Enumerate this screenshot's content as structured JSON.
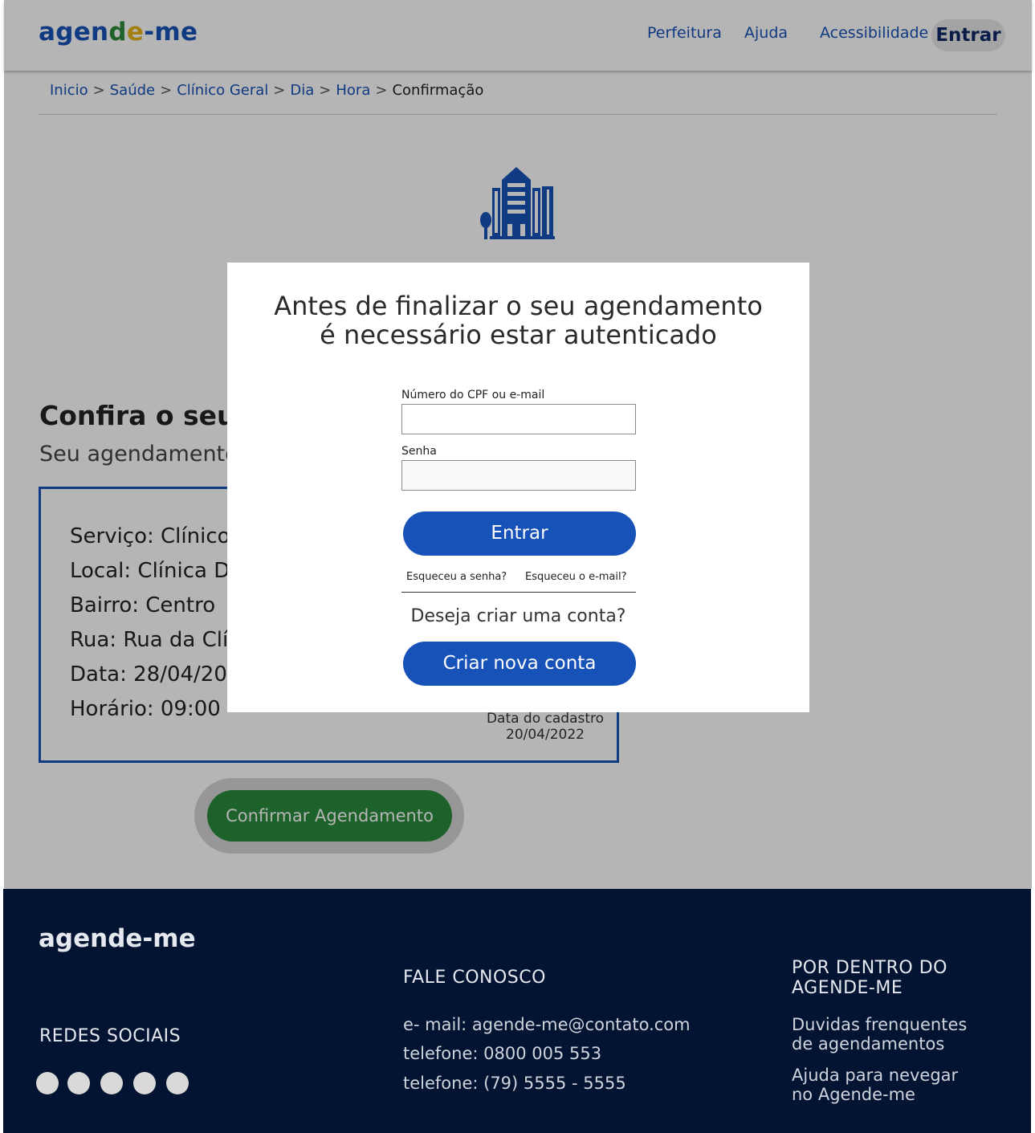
{
  "header": {
    "logo": {
      "part1": "agen",
      "part2": "d",
      "part3": "e",
      "part4": "-me"
    },
    "nav": [
      "Perfeitura",
      "Ajuda",
      "Acessibilidade"
    ],
    "login_label": "Entrar"
  },
  "breadcrumb": {
    "items": [
      "Inicio",
      "Saúde",
      "Clínico Geral",
      "Dia",
      "Hora"
    ],
    "separator": ">",
    "current": "Confirmação"
  },
  "confirmation": {
    "title": "Confira o seu",
    "subtitle": "Seu agendamento",
    "lines": {
      "service": "Serviço: Clínico",
      "place": "Local: Clínica D",
      "district": "Bairro: Centro",
      "street": "Rua: Rua da Clí",
      "date": "Data: 28/04/20",
      "time": "Horário:  09:00"
    },
    "registration_label": "Data do cadastro",
    "registration_date": "20/04/2022",
    "confirm_button": "Confirmar Agendamento"
  },
  "modal": {
    "title_line1": "Antes de finalizar o seu agendamento",
    "title_line2": "é necessário estar autenticado",
    "cpf_label": "Número do CPF ou e-mail",
    "cpf_value": "",
    "password_label": "Senha",
    "password_value": "",
    "login_button": "Entrar",
    "forgot_password": "Esqueceu a senha?",
    "forgot_email": "Esqueceu o e-mail?",
    "create_question": "Deseja criar uma conta?",
    "create_button": "Criar nova conta"
  },
  "footer": {
    "logo": "agende-me",
    "social_heading": "REDES SOCIAIS",
    "contact_heading": "FALE CONOSCO",
    "contact_email": "e- mail: agende-me@contato.com",
    "contact_phone1": "telefone: 0800 005 553",
    "contact_phone2": "telefone: (79) 5555 - 5555",
    "inside_heading_line1": "POR DENTRO DO",
    "inside_heading_line2": "AGENDE-ME",
    "link1_line1": "Duvidas frenquentes",
    "link1_line2": "de agendamentos",
    "link2_line1": "Ajuda para nevegar",
    "link2_line2": "no Agende-me"
  },
  "colors": {
    "brand_blue": "#1752b8",
    "confirm_green": "#2a8a3c",
    "footer_bg": "#031433"
  }
}
